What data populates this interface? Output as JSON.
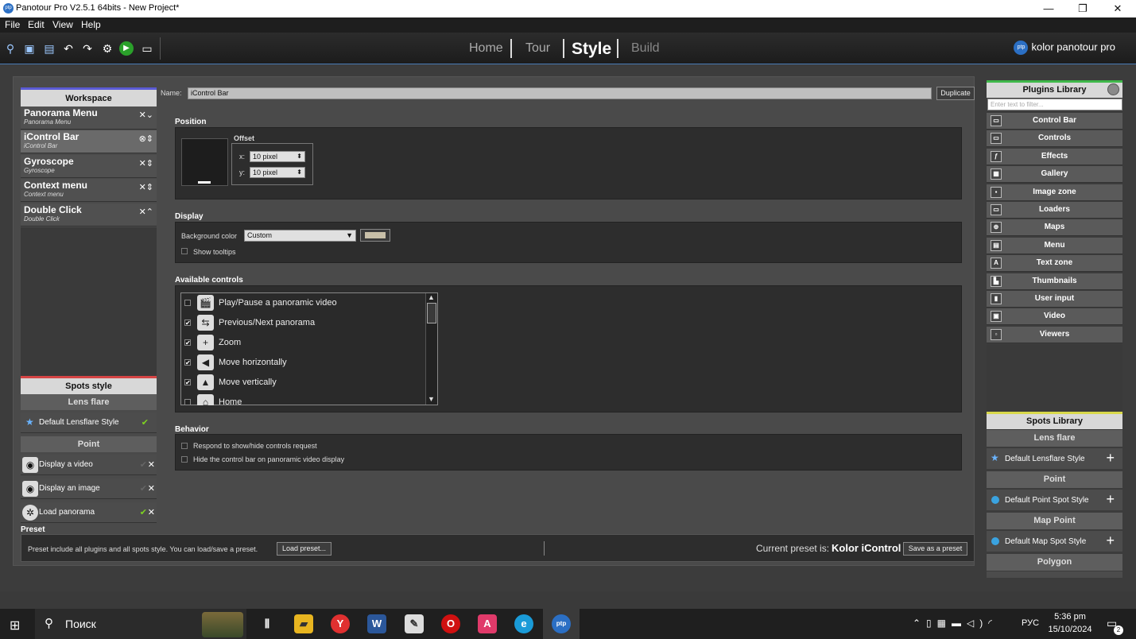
{
  "window": {
    "title": "Panotour Pro V2.5.1 64bits - New Project*",
    "app_icon": "ptp-logo-icon",
    "minimize": "—",
    "maximize": "❐",
    "close": "✕"
  },
  "menu": [
    "File",
    "Edit",
    "View",
    "Help"
  ],
  "nav": {
    "home": "Home",
    "tour": "Tour",
    "style": "Style",
    "build": "Build",
    "active": "Style"
  },
  "brand": {
    "logo": "ptp",
    "text": "kolor panotour pro"
  },
  "workspace": {
    "title": "Workspace",
    "items": [
      {
        "name": "Panorama Menu",
        "sub": "Panorama Menu",
        "ctl": "✕⌄"
      },
      {
        "name": "iControl Bar",
        "sub": "iControl Bar",
        "ctl": "⊗⇕"
      },
      {
        "name": "Gyroscope",
        "sub": "Gyroscope",
        "ctl": "✕⇕"
      },
      {
        "name": "Context menu",
        "sub": "Context menu",
        "ctl": "✕⇕"
      },
      {
        "name": "Double Click",
        "sub": "Double Click",
        "ctl": "✕⌃"
      }
    ]
  },
  "spots_style": {
    "title": "Spots style",
    "lens_flare": "Lens flare",
    "lens_item": "Default Lensflare Style",
    "point": "Point",
    "point_items": [
      {
        "label": "Display a video",
        "checked": false
      },
      {
        "label": "Display an image",
        "checked": false
      },
      {
        "label": "Load panorama",
        "checked": true
      }
    ]
  },
  "name_field": {
    "label": "Name:",
    "value": "iControl Bar",
    "duplicate": "Duplicate"
  },
  "position": {
    "title": "Position",
    "offset": "Offset",
    "x_label": "x:",
    "x_value": "10 pixel",
    "y_label": "y:",
    "y_value": "10 pixel"
  },
  "display": {
    "title": "Display",
    "bg_label": "Background color",
    "bg_value": "Custom",
    "bg_color": "#c8bfa8",
    "tooltips": "Show tooltips",
    "tooltips_checked": false
  },
  "controls": {
    "title": "Available controls",
    "items": [
      {
        "label": "Play/Pause a panoramic video",
        "checked": false,
        "icon": "🎬"
      },
      {
        "label": "Previous/Next panorama",
        "checked": true,
        "icon": "⇆"
      },
      {
        "label": "Zoom",
        "checked": true,
        "icon": "+"
      },
      {
        "label": "Move horizontally",
        "checked": true,
        "icon": "◀"
      },
      {
        "label": "Move vertically",
        "checked": true,
        "icon": "▲"
      },
      {
        "label": "Home",
        "checked": false,
        "icon": "⌂"
      }
    ]
  },
  "behavior": {
    "title": "Behavior",
    "opt1": "Respond to show/hide controls request",
    "opt2": "Hide the control bar on panoramic video display"
  },
  "preset": {
    "title": "Preset",
    "desc": "Preset include all plugins and all spots style. You can load/save a preset.",
    "load": "Load preset...",
    "current_label": "Current preset is:",
    "current_value": "Kolor iControl",
    "save": "Save as a preset"
  },
  "plugins": {
    "title": "Plugins Library",
    "filter_placeholder": "Enter text to filter...",
    "items": [
      "Control Bar",
      "Controls",
      "Effects",
      "Gallery",
      "Image zone",
      "Loaders",
      "Maps",
      "Menu",
      "Text zone",
      "Thumbnails",
      "User input",
      "Video",
      "Viewers"
    ]
  },
  "spots_library": {
    "title": "Spots Library",
    "lens_flare": "Lens flare",
    "lens_item": "Default Lensflare Style",
    "point": "Point",
    "point_item": "Default Point Spot Style",
    "map_point": "Map Point",
    "map_item": "Default Map Spot Style",
    "polygon": "Polygon"
  },
  "taskbar": {
    "search": "Поиск",
    "lang": "РУС",
    "time": "5:36 pm",
    "date": "15/10/2024",
    "notif_count": "2"
  }
}
